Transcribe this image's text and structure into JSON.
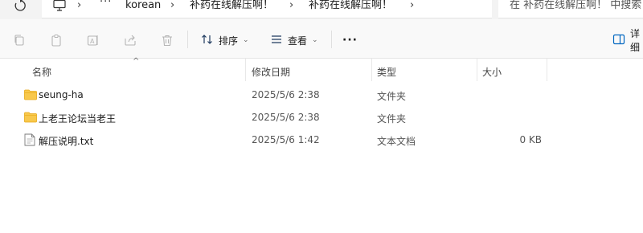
{
  "address": {
    "crumbs": [
      "korean",
      "补药在线解压啊！",
      "补药在线解压啊！"
    ],
    "more": "···",
    "search_placeholder": "在 补药在线解压啊！ 中搜索"
  },
  "toolbar": {
    "sort_label": "排序",
    "view_label": "查看",
    "more_label": "···",
    "details_label": "详细"
  },
  "columns": {
    "name": "名称",
    "date": "修改日期",
    "type": "类型",
    "size": "大小"
  },
  "rows": [
    {
      "name": "seung-ha",
      "date": "2025/5/6 2:38",
      "type": "文件夹",
      "size": "",
      "icon": "folder-icon"
    },
    {
      "name": "上老王论坛当老王",
      "date": "2025/5/6 2:38",
      "type": "文件夹",
      "size": "",
      "icon": "folder-icon"
    },
    {
      "name": "解压说明.txt",
      "date": "2025/5/6 1:42",
      "type": "文本文档",
      "size": "0 KB",
      "icon": "text-file-icon"
    }
  ],
  "colors": {
    "folder": "#f8c84c",
    "folder_dark": "#e6a817",
    "accent": "#0067c0"
  }
}
